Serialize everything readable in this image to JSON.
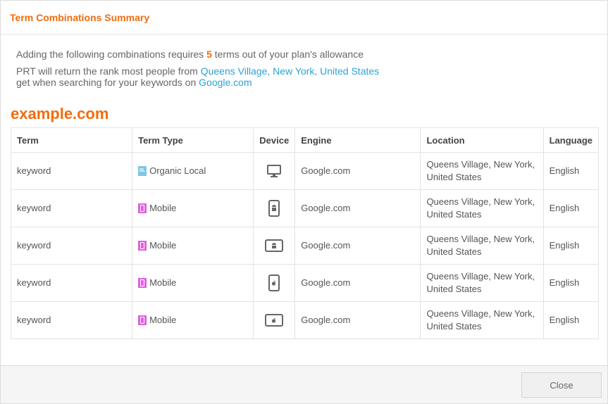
{
  "modal": {
    "title": "Term Combinations Summary"
  },
  "intro": {
    "line1_prefix": "Adding the following combinations requires",
    "count": "5",
    "line1_suffix": "terms out of your plan's allowance",
    "line2_prefix": "PRT will return the rank most people from",
    "location_link": "Queens Village, New York, United States",
    "line3_prefix": "get when searching for your keywords on",
    "engine_link": "Google.com"
  },
  "domain": "example.com",
  "table": {
    "headers": [
      "Term",
      "Term Type",
      "Device",
      "Engine",
      "Location",
      "Language"
    ],
    "rows": [
      {
        "term": "keyword",
        "type": "Organic Local",
        "type_icon": "organic-local-icon",
        "device": "desktop-icon",
        "engine": "Google.com",
        "location": "Queens Village, New York, United States",
        "language": "English"
      },
      {
        "term": "keyword",
        "type": "Mobile",
        "type_icon": "mobile-icon",
        "device": "android-phone-icon",
        "engine": "Google.com",
        "location": "Queens Village, New York, United States",
        "language": "English"
      },
      {
        "term": "keyword",
        "type": "Mobile",
        "type_icon": "mobile-icon",
        "device": "android-tablet-icon",
        "engine": "Google.com",
        "location": "Queens Village, New York, United States",
        "language": "English"
      },
      {
        "term": "keyword",
        "type": "Mobile",
        "type_icon": "mobile-icon",
        "device": "iphone-icon",
        "engine": "Google.com",
        "location": "Queens Village, New York, United States",
        "language": "English"
      },
      {
        "term": "keyword",
        "type": "Mobile",
        "type_icon": "mobile-icon",
        "device": "ipad-icon",
        "engine": "Google.com",
        "location": "Queens Village, New York, United States",
        "language": "English"
      }
    ]
  },
  "footer": {
    "close_label": "Close"
  },
  "colors": {
    "accent": "#f26c0d",
    "link": "#2aa2d6",
    "mobile_badge": "#e060e0",
    "local_badge": "#7cc7e3"
  }
}
